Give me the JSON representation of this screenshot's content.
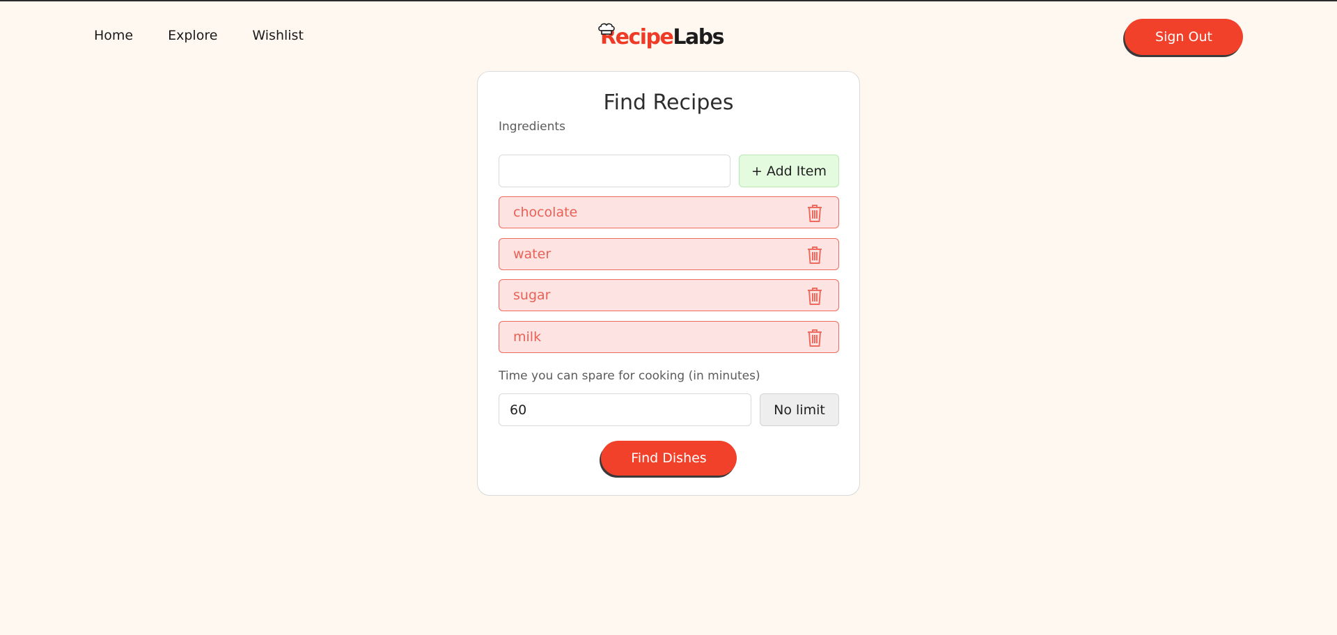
{
  "nav": {
    "links": [
      "Home",
      "Explore",
      "Wishlist"
    ],
    "brand_part1": "Recipe",
    "brand_part2": "Labs",
    "signout_label": "Sign Out"
  },
  "card": {
    "title": "Find Recipes",
    "ingredients_label": "Ingredients",
    "ingredient_input_value": "",
    "add_item_label": "+ Add Item",
    "ingredients": [
      "chocolate",
      "water",
      "sugar",
      "milk"
    ],
    "time_label": "Time you can spare for cooking (in minutes)",
    "time_value": "60",
    "no_limit_label": "No limit",
    "find_label": "Find Dishes"
  },
  "colors": {
    "background": "#fff8f1",
    "accent": "#f2412a",
    "ingredient_bg": "#fde3e1",
    "ingredient_text": "#e96156",
    "add_item_bg": "#e4fbdf"
  },
  "icons": {
    "logo": "chef-hat-icon",
    "remove": "trash-icon"
  }
}
